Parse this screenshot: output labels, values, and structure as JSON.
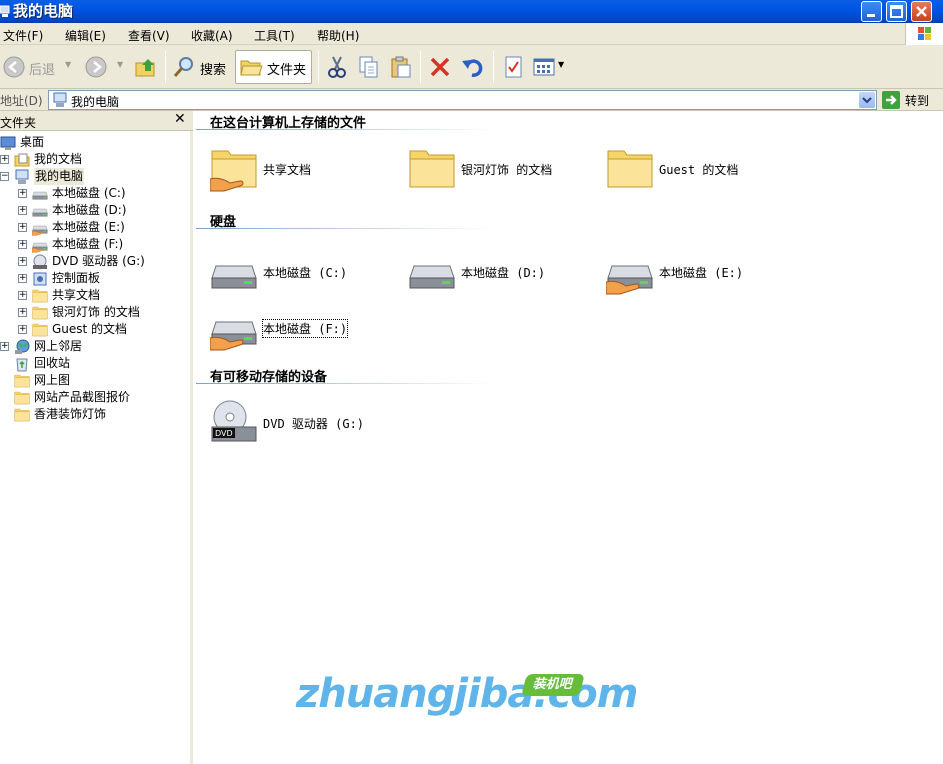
{
  "window": {
    "title": "我的电脑"
  },
  "menu": [
    "文件(F)",
    "编辑(E)",
    "查看(V)",
    "收藏(A)",
    "工具(T)",
    "帮助(H)"
  ],
  "toolbar": {
    "back_label": "后退",
    "search_label": "搜索",
    "folders_label": "文件夹"
  },
  "address": {
    "label": "地址(D)",
    "value": "我的电脑",
    "go_label": "转到"
  },
  "folder_pane": {
    "title": "文件夹",
    "tree": [
      {
        "label": "桌面",
        "icon": "desktop-icon"
      },
      {
        "label": "我的文档",
        "icon": "my-documents-icon",
        "expander": "+"
      },
      {
        "label": "我的电脑",
        "icon": "my-computer-icon",
        "expander": "−",
        "selected": true
      },
      {
        "label": "本地磁盘 (C:)",
        "icon": "drive-icon",
        "expander": "+"
      },
      {
        "label": "本地磁盘 (D:)",
        "icon": "drive-icon",
        "expander": "+"
      },
      {
        "label": "本地磁盘 (E:)",
        "icon": "shared-drive-icon",
        "expander": "+"
      },
      {
        "label": "本地磁盘 (F:)",
        "icon": "shared-drive-icon",
        "expander": "+"
      },
      {
        "label": "DVD 驱动器 (G:)",
        "icon": "dvd-icon",
        "expander": "+"
      },
      {
        "label": "控制面板",
        "icon": "control-panel-icon",
        "expander": "+"
      },
      {
        "label": "共享文档",
        "icon": "folder-icon",
        "expander": "+"
      },
      {
        "label": "银河灯饰 的文档",
        "icon": "folder-icon",
        "expander": "+"
      },
      {
        "label": "Guest 的文档",
        "icon": "folder-icon",
        "expander": "+"
      },
      {
        "label": "网上邻居",
        "icon": "network-icon",
        "expander": "+"
      },
      {
        "label": "回收站",
        "icon": "recycle-bin-icon"
      },
      {
        "label": "网上图",
        "icon": "folder-icon"
      },
      {
        "label": "网站产品截图报价",
        "icon": "folder-icon"
      },
      {
        "label": "香港装饰灯饰",
        "icon": "folder-icon"
      }
    ]
  },
  "content": {
    "groups": [
      {
        "header": "在这台计算机上存储的文件",
        "items": [
          {
            "label": "共享文档",
            "icon": "shared-folder-icon"
          },
          {
            "label": "银河灯饰 的文档",
            "icon": "folder-icon"
          },
          {
            "label": "Guest 的文档",
            "icon": "folder-icon"
          }
        ]
      },
      {
        "header": "硬盘",
        "items": [
          {
            "label": "本地磁盘 (C:)",
            "icon": "drive-icon"
          },
          {
            "label": "本地磁盘 (D:)",
            "icon": "drive-icon"
          },
          {
            "label": "本地磁盘 (E:)",
            "icon": "shared-drive-icon"
          },
          {
            "label": "本地磁盘 (F:)",
            "icon": "shared-drive-icon"
          }
        ]
      },
      {
        "header": "有可移动存储的设备",
        "items": [
          {
            "label": "DVD 驱动器 (G:)",
            "icon": "dvd-drive-icon"
          }
        ]
      }
    ]
  },
  "watermark": {
    "text": "zhuangjiba.com",
    "badge": "装机吧"
  },
  "colors": {
    "titlebar": "#0054e3",
    "chrome": "#ece9d8",
    "group_line": "#7fa0d0",
    "watermark": "#5fb4ea"
  }
}
